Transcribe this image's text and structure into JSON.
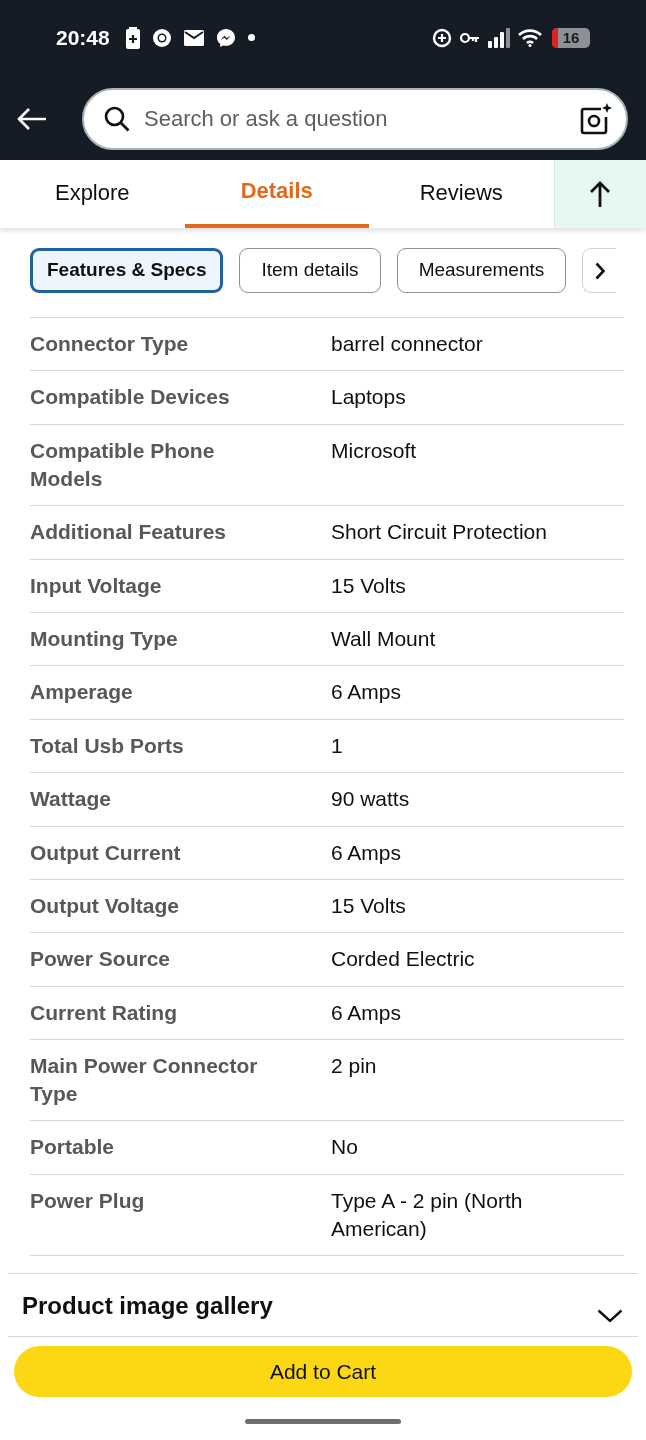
{
  "status_bar": {
    "time": "20:48",
    "battery": "16"
  },
  "search": {
    "placeholder": "Search or ask a question"
  },
  "tabs": [
    {
      "label": "Explore",
      "selected": false
    },
    {
      "label": "Details",
      "selected": true
    },
    {
      "label": "Reviews",
      "selected": false
    }
  ],
  "chips": [
    {
      "label": "Features & Specs",
      "selected": true
    },
    {
      "label": "Item details",
      "selected": false
    },
    {
      "label": "Measurements",
      "selected": false
    }
  ],
  "specs": [
    {
      "name": "Connector Type",
      "value": "barrel connector"
    },
    {
      "name": "Compatible Devices",
      "value": "Laptops"
    },
    {
      "name": "Compatible Phone Models",
      "value": "Microsoft"
    },
    {
      "name": "Additional Features",
      "value": "Short Circuit Protection"
    },
    {
      "name": "Input Voltage",
      "value": "15 Volts"
    },
    {
      "name": "Mounting Type",
      "value": "Wall Mount"
    },
    {
      "name": "Amperage",
      "value": "6 Amps"
    },
    {
      "name": "Total Usb Ports",
      "value": "1"
    },
    {
      "name": "Wattage",
      "value": "90 watts"
    },
    {
      "name": "Output Current",
      "value": "6 Amps"
    },
    {
      "name": "Output Voltage",
      "value": "15 Volts"
    },
    {
      "name": "Power Source",
      "value": "Corded Electric"
    },
    {
      "name": "Current Rating",
      "value": "6 Amps"
    },
    {
      "name": "Main Power Connector Type",
      "value": "2 pin"
    },
    {
      "name": "Portable",
      "value": "No"
    },
    {
      "name": "Power Plug",
      "value": "Type A - 2 pin (North American)"
    }
  ],
  "gallery": {
    "title": "Product image gallery",
    "expanded": false
  },
  "add_to_cart": {
    "label": "Add to Cart"
  }
}
